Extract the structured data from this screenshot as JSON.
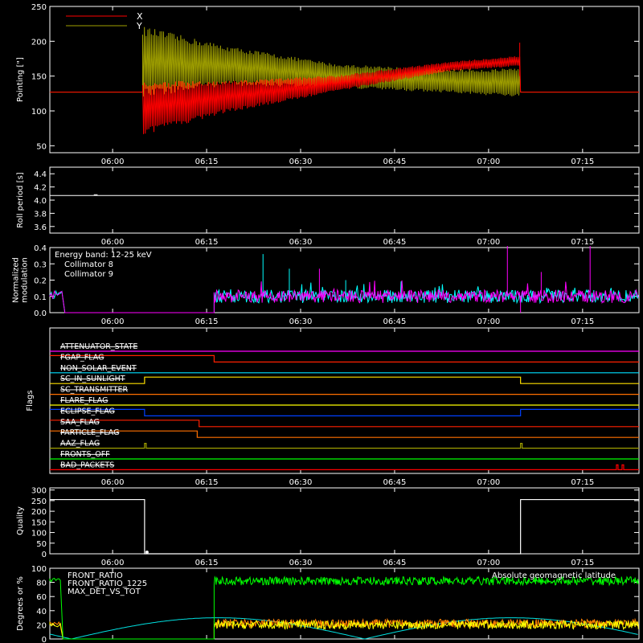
{
  "time_ticks": [
    "06:00",
    "06:15",
    "06:30",
    "06:45",
    "07:00",
    "07:15"
  ],
  "x_range_hours": [
    5.833,
    7.4
  ],
  "chart_data": [
    {
      "type": "line",
      "ylabel": "Pointing [\"]",
      "ylim": [
        40,
        250
      ],
      "yticks": [
        "50",
        "100",
        "150",
        "200",
        "250"
      ],
      "legend": [
        "X",
        "Y"
      ],
      "legend_placement": "top-left",
      "series": [
        {
          "name": "X",
          "color": "#ff0000",
          "baseline": 127,
          "envelope": {
            "t": [
              6.08,
              6.3,
              6.6,
              6.9,
              7.08
            ],
            "low": [
              70,
              100,
              130,
              158,
              165
            ],
            "high": [
              138,
              140,
              150,
              170,
              178
            ]
          },
          "end_spike": 198
        },
        {
          "name": "Y",
          "color": "#a0a000",
          "baseline": 127,
          "envelope": {
            "t": [
              6.08,
              6.3,
              6.6,
              6.9,
              7.08
            ],
            "low": [
              125,
              140,
              135,
              128,
              122
            ],
            "high": [
              215,
              190,
              165,
              158,
              158
            ]
          }
        }
      ]
    },
    {
      "type": "line",
      "ylabel": "Roll period [s]",
      "ylim": [
        3.5,
        4.5
      ],
      "yticks": [
        "3.6",
        "3.8",
        "4.0",
        "4.2",
        "4.4"
      ],
      "series": [
        {
          "name": "",
          "color": "#ffffff",
          "values_description_value": 4.07
        }
      ]
    },
    {
      "type": "line",
      "ylabel": "Normalized modulation",
      "ylim": [
        0,
        0.4
      ],
      "yticks": [
        "0.0",
        "0.1",
        "0.2",
        "0.3",
        "0.4"
      ],
      "annotation": "Energy band: 12-25 keV",
      "series": [
        {
          "name": "Collimator 8",
          "color": "#00ffff",
          "start_t": 6.27,
          "mean": 0.1,
          "spikes": [
            [
              6.4,
              0.36
            ],
            [
              6.47,
              0.27
            ],
            [
              6.62,
              0.2
            ]
          ]
        },
        {
          "name": "Collimator 9",
          "color": "#ff00ff",
          "start_t": 6.27,
          "mean": 0.1,
          "spikes": [
            [
              7.05,
              0.41
            ],
            [
              7.27,
              0.41
            ],
            [
              6.55,
              0.27
            ],
            [
              7.14,
              0.25
            ]
          ]
        }
      ]
    },
    {
      "type": "line",
      "ylabel": "Flags",
      "flags": [
        {
          "name": "ATTENUATOR_STATE",
          "color": "#ff00ff",
          "steps": []
        },
        {
          "name": "FGAP_FLAG",
          "color": "#ff2000",
          "steps": [
            [
              6.27,
              -1
            ]
          ]
        },
        {
          "name": "NON_SOLAR_EVENT",
          "color": "#00e0ff",
          "steps": []
        },
        {
          "name": "SC_IN_SUNLIGHT",
          "color": "#ffe000",
          "steps": [
            [
              6.085,
              1
            ],
            [
              7.085,
              -1
            ]
          ]
        },
        {
          "name": "SC_TRANSMITTER",
          "color": "#ff7000",
          "steps": []
        },
        {
          "name": "FLARE_FLAG",
          "color": "#ffff00",
          "steps": []
        },
        {
          "name": "ECLIPSE_FLAG",
          "color": "#0040ff",
          "steps": [
            [
              6.085,
              -1
            ],
            [
              7.085,
              1
            ]
          ]
        },
        {
          "name": "SAA_FLAG",
          "color": "#ff2000",
          "steps": [
            [
              6.23,
              -1
            ]
          ]
        },
        {
          "name": "PARTICLE_FLAG",
          "color": "#ff7000",
          "steps": [
            [
              6.225,
              -1
            ]
          ]
        },
        {
          "name": "AAZ_FLAG",
          "color": "#a0a000",
          "pulses": [
            6.085,
            7.085
          ]
        },
        {
          "name": "FRONTS_OFF",
          "color": "#00ff00",
          "steps": []
        },
        {
          "name": "BAD_PACKETS",
          "color": "#ff0000",
          "pulses": [
            7.34,
            7.355
          ]
        }
      ]
    },
    {
      "type": "line",
      "ylabel": "Quality",
      "ylim": [
        0,
        310
      ],
      "yticks": [
        "0",
        "50",
        "100",
        "150",
        "200",
        "250",
        "300"
      ],
      "series": [
        {
          "name": "",
          "color": "#ffffff",
          "segments": [
            [
              5.833,
              6.085,
              255
            ],
            [
              6.085,
              7.085,
              0
            ],
            [
              7.085,
              7.4,
              255
            ]
          ]
        }
      ]
    },
    {
      "type": "line",
      "ylabel": "Degrees or %",
      "ylim": [
        0,
        100
      ],
      "yticks": [
        "0",
        "20",
        "40",
        "60",
        "80",
        "100"
      ],
      "annotation": "Absolute geomagnetic latitude",
      "series": [
        {
          "name": "FRONT_RATIO",
          "color": "#ffff00",
          "start_t": 6.27,
          "mean": 20
        },
        {
          "name": "FRONT_RATIO_1225",
          "color": "#00ff00",
          "start_t": 6.27,
          "mean": 82
        },
        {
          "name": "MAX_DET_VS_TOT",
          "color": "#ff8000",
          "start_t": 6.27,
          "mean": 22
        },
        {
          "name": "Absolute geomagnetic latitude",
          "color": "#00e0e0",
          "peak": 30,
          "period_h": 0.78,
          "phase_t": 5.89
        }
      ]
    }
  ]
}
